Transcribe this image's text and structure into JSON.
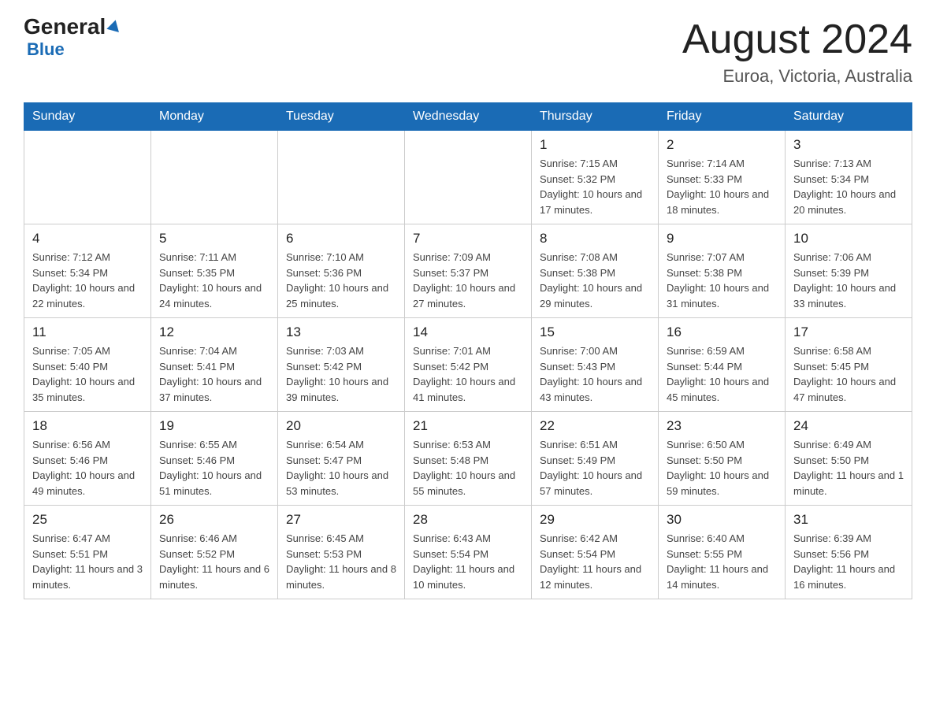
{
  "header": {
    "logo_general": "General",
    "logo_blue": "Blue",
    "month": "August 2024",
    "location": "Euroa, Victoria, Australia"
  },
  "weekdays": [
    "Sunday",
    "Monday",
    "Tuesday",
    "Wednesday",
    "Thursday",
    "Friday",
    "Saturday"
  ],
  "weeks": [
    [
      {
        "day": "",
        "info": ""
      },
      {
        "day": "",
        "info": ""
      },
      {
        "day": "",
        "info": ""
      },
      {
        "day": "",
        "info": ""
      },
      {
        "day": "1",
        "info": "Sunrise: 7:15 AM\nSunset: 5:32 PM\nDaylight: 10 hours and 17 minutes."
      },
      {
        "day": "2",
        "info": "Sunrise: 7:14 AM\nSunset: 5:33 PM\nDaylight: 10 hours and 18 minutes."
      },
      {
        "day": "3",
        "info": "Sunrise: 7:13 AM\nSunset: 5:34 PM\nDaylight: 10 hours and 20 minutes."
      }
    ],
    [
      {
        "day": "4",
        "info": "Sunrise: 7:12 AM\nSunset: 5:34 PM\nDaylight: 10 hours and 22 minutes."
      },
      {
        "day": "5",
        "info": "Sunrise: 7:11 AM\nSunset: 5:35 PM\nDaylight: 10 hours and 24 minutes."
      },
      {
        "day": "6",
        "info": "Sunrise: 7:10 AM\nSunset: 5:36 PM\nDaylight: 10 hours and 25 minutes."
      },
      {
        "day": "7",
        "info": "Sunrise: 7:09 AM\nSunset: 5:37 PM\nDaylight: 10 hours and 27 minutes."
      },
      {
        "day": "8",
        "info": "Sunrise: 7:08 AM\nSunset: 5:38 PM\nDaylight: 10 hours and 29 minutes."
      },
      {
        "day": "9",
        "info": "Sunrise: 7:07 AM\nSunset: 5:38 PM\nDaylight: 10 hours and 31 minutes."
      },
      {
        "day": "10",
        "info": "Sunrise: 7:06 AM\nSunset: 5:39 PM\nDaylight: 10 hours and 33 minutes."
      }
    ],
    [
      {
        "day": "11",
        "info": "Sunrise: 7:05 AM\nSunset: 5:40 PM\nDaylight: 10 hours and 35 minutes."
      },
      {
        "day": "12",
        "info": "Sunrise: 7:04 AM\nSunset: 5:41 PM\nDaylight: 10 hours and 37 minutes."
      },
      {
        "day": "13",
        "info": "Sunrise: 7:03 AM\nSunset: 5:42 PM\nDaylight: 10 hours and 39 minutes."
      },
      {
        "day": "14",
        "info": "Sunrise: 7:01 AM\nSunset: 5:42 PM\nDaylight: 10 hours and 41 minutes."
      },
      {
        "day": "15",
        "info": "Sunrise: 7:00 AM\nSunset: 5:43 PM\nDaylight: 10 hours and 43 minutes."
      },
      {
        "day": "16",
        "info": "Sunrise: 6:59 AM\nSunset: 5:44 PM\nDaylight: 10 hours and 45 minutes."
      },
      {
        "day": "17",
        "info": "Sunrise: 6:58 AM\nSunset: 5:45 PM\nDaylight: 10 hours and 47 minutes."
      }
    ],
    [
      {
        "day": "18",
        "info": "Sunrise: 6:56 AM\nSunset: 5:46 PM\nDaylight: 10 hours and 49 minutes."
      },
      {
        "day": "19",
        "info": "Sunrise: 6:55 AM\nSunset: 5:46 PM\nDaylight: 10 hours and 51 minutes."
      },
      {
        "day": "20",
        "info": "Sunrise: 6:54 AM\nSunset: 5:47 PM\nDaylight: 10 hours and 53 minutes."
      },
      {
        "day": "21",
        "info": "Sunrise: 6:53 AM\nSunset: 5:48 PM\nDaylight: 10 hours and 55 minutes."
      },
      {
        "day": "22",
        "info": "Sunrise: 6:51 AM\nSunset: 5:49 PM\nDaylight: 10 hours and 57 minutes."
      },
      {
        "day": "23",
        "info": "Sunrise: 6:50 AM\nSunset: 5:50 PM\nDaylight: 10 hours and 59 minutes."
      },
      {
        "day": "24",
        "info": "Sunrise: 6:49 AM\nSunset: 5:50 PM\nDaylight: 11 hours and 1 minute."
      }
    ],
    [
      {
        "day": "25",
        "info": "Sunrise: 6:47 AM\nSunset: 5:51 PM\nDaylight: 11 hours and 3 minutes."
      },
      {
        "day": "26",
        "info": "Sunrise: 6:46 AM\nSunset: 5:52 PM\nDaylight: 11 hours and 6 minutes."
      },
      {
        "day": "27",
        "info": "Sunrise: 6:45 AM\nSunset: 5:53 PM\nDaylight: 11 hours and 8 minutes."
      },
      {
        "day": "28",
        "info": "Sunrise: 6:43 AM\nSunset: 5:54 PM\nDaylight: 11 hours and 10 minutes."
      },
      {
        "day": "29",
        "info": "Sunrise: 6:42 AM\nSunset: 5:54 PM\nDaylight: 11 hours and 12 minutes."
      },
      {
        "day": "30",
        "info": "Sunrise: 6:40 AM\nSunset: 5:55 PM\nDaylight: 11 hours and 14 minutes."
      },
      {
        "day": "31",
        "info": "Sunrise: 6:39 AM\nSunset: 5:56 PM\nDaylight: 11 hours and 16 minutes."
      }
    ]
  ]
}
